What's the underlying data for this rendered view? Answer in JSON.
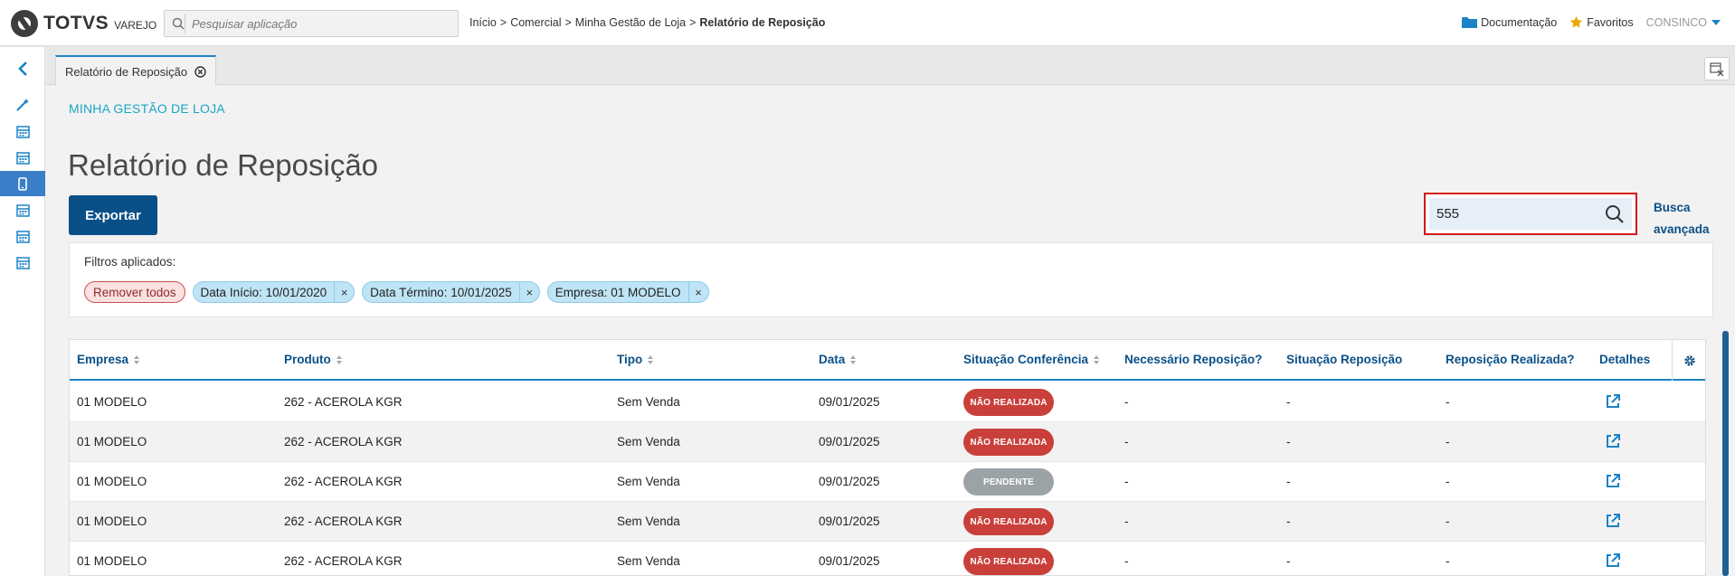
{
  "header": {
    "logo_text": "TOTVS",
    "logo_sub": "VAREJO",
    "search_placeholder": "Pesquisar aplicação",
    "breadcrumb": [
      "Início",
      "Comercial",
      "Minha Gestão de Loja",
      "Relatório de Reposição"
    ],
    "breadcrumb_sep": ">",
    "docs_label": "Documentação",
    "favorites_label": "Favoritos",
    "user_label": "CONSINCO"
  },
  "tab": {
    "label": "Relatório de Reposição"
  },
  "page": {
    "section": "MINHA GESTÃO DE LOJA",
    "title": "Relatório de Reposição",
    "export_label": "Exportar",
    "search_value": "555",
    "advanced_search": [
      "Busca",
      "avançada"
    ]
  },
  "filters": {
    "label": "Filtros aplicados:",
    "remove_all": "Remover todos",
    "chips": [
      "Data Início: 10/01/2020",
      "Data Término: 10/01/2025",
      "Empresa: 01 MODELO"
    ],
    "chip_close": "×"
  },
  "table": {
    "columns": [
      "Empresa",
      "Produto",
      "Tipo",
      "Data",
      "Situação Conferência",
      "Necessário Reposição?",
      "Situação Reposição",
      "Reposição Realizada?",
      "Detalhes"
    ],
    "rows": [
      {
        "empresa": "01 MODELO",
        "produto": "262 - ACEROLA KGR",
        "tipo": "Sem Venda",
        "data": "09/01/2025",
        "situacao": "NÃO REALIZADA",
        "status": "red",
        "necessario": "-",
        "sit_reposicao": "-",
        "realizada": "-"
      },
      {
        "empresa": "01 MODELO",
        "produto": "262 - ACEROLA KGR",
        "tipo": "Sem Venda",
        "data": "09/01/2025",
        "situacao": "NÃO REALIZADA",
        "status": "red",
        "necessario": "-",
        "sit_reposicao": "-",
        "realizada": "-"
      },
      {
        "empresa": "01 MODELO",
        "produto": "262 - ACEROLA KGR",
        "tipo": "Sem Venda",
        "data": "09/01/2025",
        "situacao": "PENDENTE",
        "status": "grey",
        "necessario": "-",
        "sit_reposicao": "-",
        "realizada": "-"
      },
      {
        "empresa": "01 MODELO",
        "produto": "262 - ACEROLA KGR",
        "tipo": "Sem Venda",
        "data": "09/01/2025",
        "situacao": "NÃO REALIZADA",
        "status": "red",
        "necessario": "-",
        "sit_reposicao": "-",
        "realizada": "-"
      },
      {
        "empresa": "01 MODELO",
        "produto": "262 - ACEROLA KGR",
        "tipo": "Sem Venda",
        "data": "09/01/2025",
        "situacao": "NÃO REALIZADA",
        "status": "red",
        "necessario": "-",
        "sit_reposicao": "-",
        "realizada": "-"
      }
    ]
  },
  "sidebar": {
    "icons": [
      "collapse-arrow-icon",
      "wand-icon",
      "calendar-icon",
      "calendar-icon",
      "mobile-icon",
      "calendar-icon",
      "calendar-icon",
      "calendar-icon"
    ]
  },
  "colors": {
    "primary": "#0a5088",
    "accent": "#1aa6c5",
    "status_red": "#c9403b",
    "status_grey": "#9ca3a6",
    "highlight_border": "#d11a1a"
  }
}
